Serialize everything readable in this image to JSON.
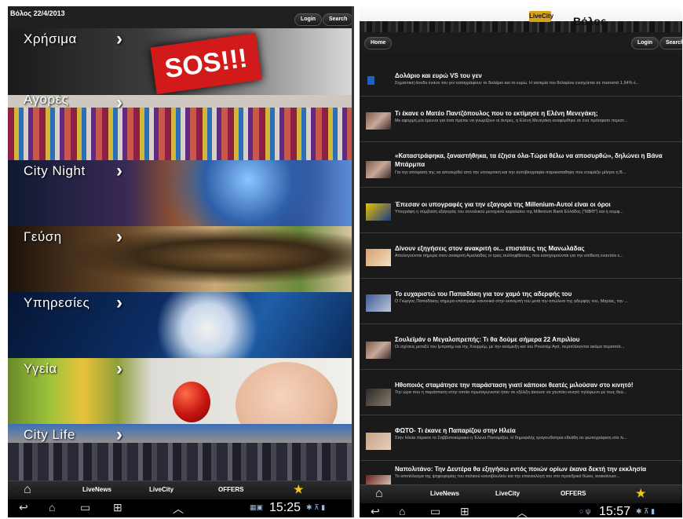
{
  "left": {
    "date": "Βόλος 22/4/2013",
    "login": "Login",
    "search": "Search",
    "sos_text": "SOS!!!",
    "categories": [
      {
        "label": "Χρήσιμα"
      },
      {
        "label": "Αγορές"
      },
      {
        "label": "City Night"
      },
      {
        "label": "Γεύση"
      },
      {
        "label": "Υπηρεσίες"
      },
      {
        "label": "Υγεία"
      },
      {
        "label": "City Life"
      }
    ],
    "nav": {
      "livenews": "LiveNews",
      "livecity": "LiveCity",
      "offers": "OFFERS"
    },
    "clock": "15:25"
  },
  "right": {
    "logo_city": "LiveCity",
    "logo_volos": "Βόλος",
    "home": "Home",
    "login": "Login",
    "search": "Search",
    "news": [
      {
        "title": "Δολάριο και ευρώ VS του γεν",
        "snippet": "Σημαντική άνοδο έναντι του γεν καταγράφουν το δολάριο και το ευρώ. Η ισοτιμία του δολαρίου ενισχύεται σε ποσοστό 1,54% έ..."
      },
      {
        "title": "Τι έκανε ο Ματέο Παντζόπουλος που το εκτίμησε η Ελένη Μενεγάκη;",
        "snippet": "Με αφορμή μία έρευνα για όσα πρέπει να γνωρίζουν οι άντρες, η Ελένη Μενεγάκη αναφέρθηκε σε ένα πρόσφατο περιστ..."
      },
      {
        "title": "«Καταστράφηκα, ξαναστήθηκα, τα έζησα όλα-Τώρα θέλω να αποσυρθώ», δηλώνει η Βάνα Μπάρμπα",
        "snippet": "Για την απόφασή της να αποσυρθεί από την υποκριτική και την αυτοβιογραφία-παρακαταθήκη που ετοιμάζει μίλησε η Β..."
      },
      {
        "title": "Έπεσαν οι υπογραφές για την εξαγορά της Millenium-Αυτοί είναι οι όροι",
        "snippet": "Υπεγράφη η σύμβαση εξαγοράς του συνολικού μετοχικού κεφαλαίου της Millenium Bank Ελλάδος (\"ΜΒΘ\") και η συμφ..."
      },
      {
        "title": "Δίνουν εξηγήσεις στον ανακριτή οι... επιστάτες της Μανωλάδας",
        "snippet": "Απολογούνται σήμερα στον ανακριτή Αμαλιάδας οι τρεις συλληφθέντες, που κατηγορούνται για την επίθεση εναντίον ε..."
      },
      {
        "title": "Το ευχαριστώ του Παπαδάκη για τον χαμό της αδερφής του",
        "snippet": "Ο Γιώργος Παπαδάκης σήμερα επέστρεψε κανονικά στην εκπομπή του μετά την απώλεια της αδερφής του, Μαρίας, την ..."
      },
      {
        "title": "Σουλεϊμάν ο Μεγαλοπρεπής: Τι θα δούμε σήμερα 22 Απριλίου",
        "snippet": "Οι σχέσεις μεταξύ του Ιμπραήμ και της Χουρρέμ, με την ανάμειξη και του Ρουστέμ Αγά, περιπλέκονται ακόμα περισσότ..."
      },
      {
        "title": "Ηθοποιός σταμάτησε την παράσταση γιατί κάποιοι θεατές μιλούσαν στο κινητό!",
        "snippet": "Την ώρα που η παράσταση στην οποία πρωταγωνιστεί ήταν σε εξέλιξη άκουσε να χτυπάει κινητό τηλέφωνο με τους θεα..."
      },
      {
        "title": "ΦΩΤΟ- Τι έκανε η Παπαρίζου στην Ηλεία",
        "snippet": "Στην Ηλεία πέρασε το Σαββατοκύριακο η Έλενα Παπαρίζου. Η δημοφιλής τραγουδίστρια εθεάθη σε φωτογράφιση στο λι..."
      },
      {
        "title": "Ναπολιτάνο: Την Δευτέρα θα εξηγήσω εντός ποιών ορίων έκανα δεκτή την εκκλησία",
        "snippet": "Το αποτέλεσμα της ψηφοφορίας του ιταλικού κοινοβουλίου και την επανεκλογή του στο προεδρικό θώκο, ανακοίνωσ..."
      }
    ],
    "nav": {
      "livenews": "LiveNews",
      "livecity": "LiveCity",
      "offers": "OFFERS"
    },
    "clock": "15:57"
  }
}
